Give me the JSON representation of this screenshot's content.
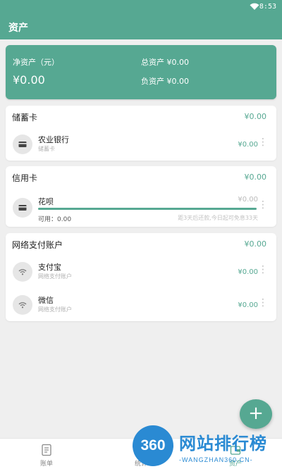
{
  "status": {
    "time": "8:53"
  },
  "appbar": {
    "title": "资产"
  },
  "summary": {
    "net_label": "净资产（元）",
    "net_value": "¥0.00",
    "total_label": "总资产",
    "total_value": "¥0.00",
    "debt_label": "负资产",
    "debt_value": "¥0.00"
  },
  "sections": [
    {
      "name": "储蓄卡",
      "amount": "¥0.00",
      "items": [
        {
          "title": "农业银行",
          "sub": "储蓄卡",
          "value": "¥0.00",
          "icon": "card-icon"
        }
      ]
    },
    {
      "name": "信用卡",
      "amount": "¥0.00",
      "items": [
        {
          "title": "花呗",
          "value": "¥0.00",
          "available_label": "可用：",
          "available_value": "0.00",
          "due": "距3天后还款,今日起可免息33天",
          "icon": "card-icon",
          "usage": 1.0
        }
      ]
    },
    {
      "name": "网络支付账户",
      "amount": "¥0.00",
      "items": [
        {
          "title": "支付宝",
          "sub": "网络支付账户",
          "value": "¥0.00",
          "icon": "wifi-icon"
        },
        {
          "title": "微信",
          "sub": "网络支付账户",
          "value": "¥0.00",
          "icon": "wifi-icon"
        }
      ]
    }
  ],
  "fab": {
    "label": "+"
  },
  "bottom_nav": [
    {
      "label": "账单",
      "icon": "bill-icon"
    },
    {
      "label": "统计",
      "icon": "chart-icon"
    },
    {
      "label": "资产",
      "icon": "wallet-icon"
    }
  ],
  "watermark": {
    "badge": "360",
    "cn": "网站排行榜",
    "en": "-WANGZHAN360.CN-"
  },
  "colors": {
    "primary": "#56a892",
    "background": "#efefef"
  }
}
